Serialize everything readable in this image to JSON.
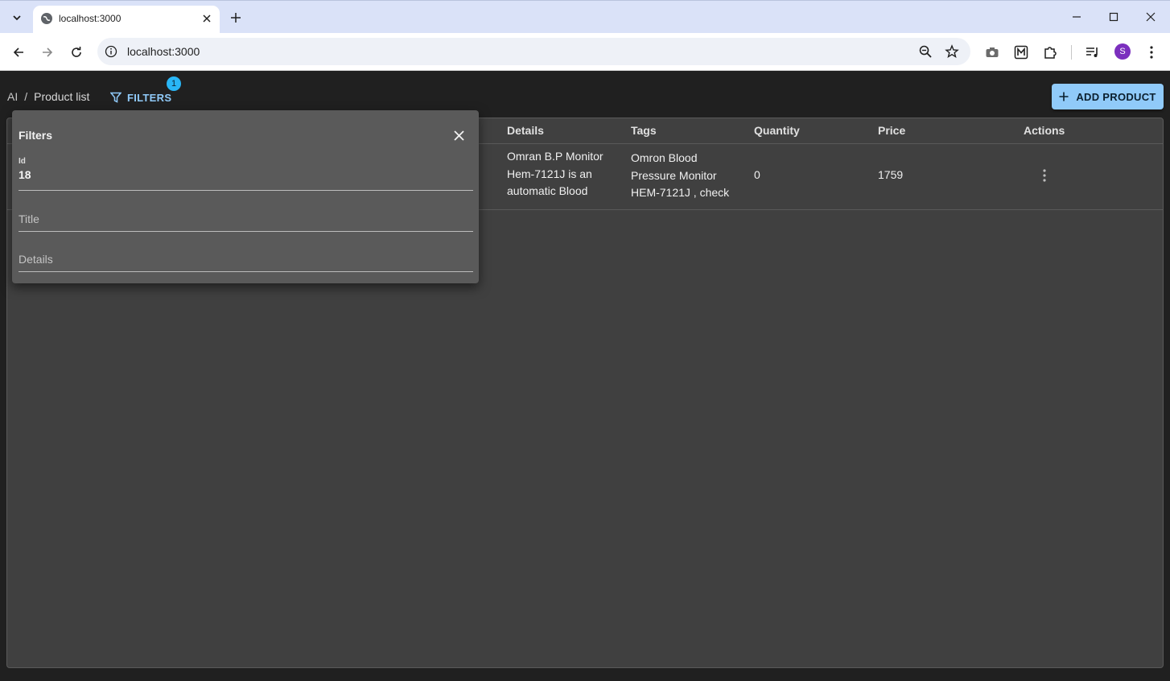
{
  "browser": {
    "tab_title": "localhost:3000",
    "url": "localhost:3000",
    "profile_initial": "S"
  },
  "app": {
    "breadcrumb": {
      "root": "AI",
      "separator": "/",
      "current": "Product list"
    },
    "filters_label": "FILTERS",
    "filters_count": "1",
    "add_product_label": "ADD PRODUCT"
  },
  "grid": {
    "columns": [
      "Details",
      "Tags",
      "Quantity",
      "Price",
      "Actions"
    ],
    "rows": [
      {
        "details": [
          "Omran B.P Monitor",
          "Hem-7121J is an",
          "automatic Blood"
        ],
        "tags": [
          "Omron Blood",
          "Pressure Monitor",
          "HEM-7121J , check"
        ],
        "quantity": "0",
        "price": "1759"
      }
    ]
  },
  "filters_panel": {
    "title": "Filters",
    "id_label": "Id",
    "id_value": "18",
    "title_placeholder": "Title",
    "details_placeholder": "Details"
  },
  "colors": {
    "accent": "#90caf9",
    "badge": "#29b6f6",
    "surface": "#404040",
    "panel": "#5a5a5a",
    "profile": "#7b2fbe"
  }
}
